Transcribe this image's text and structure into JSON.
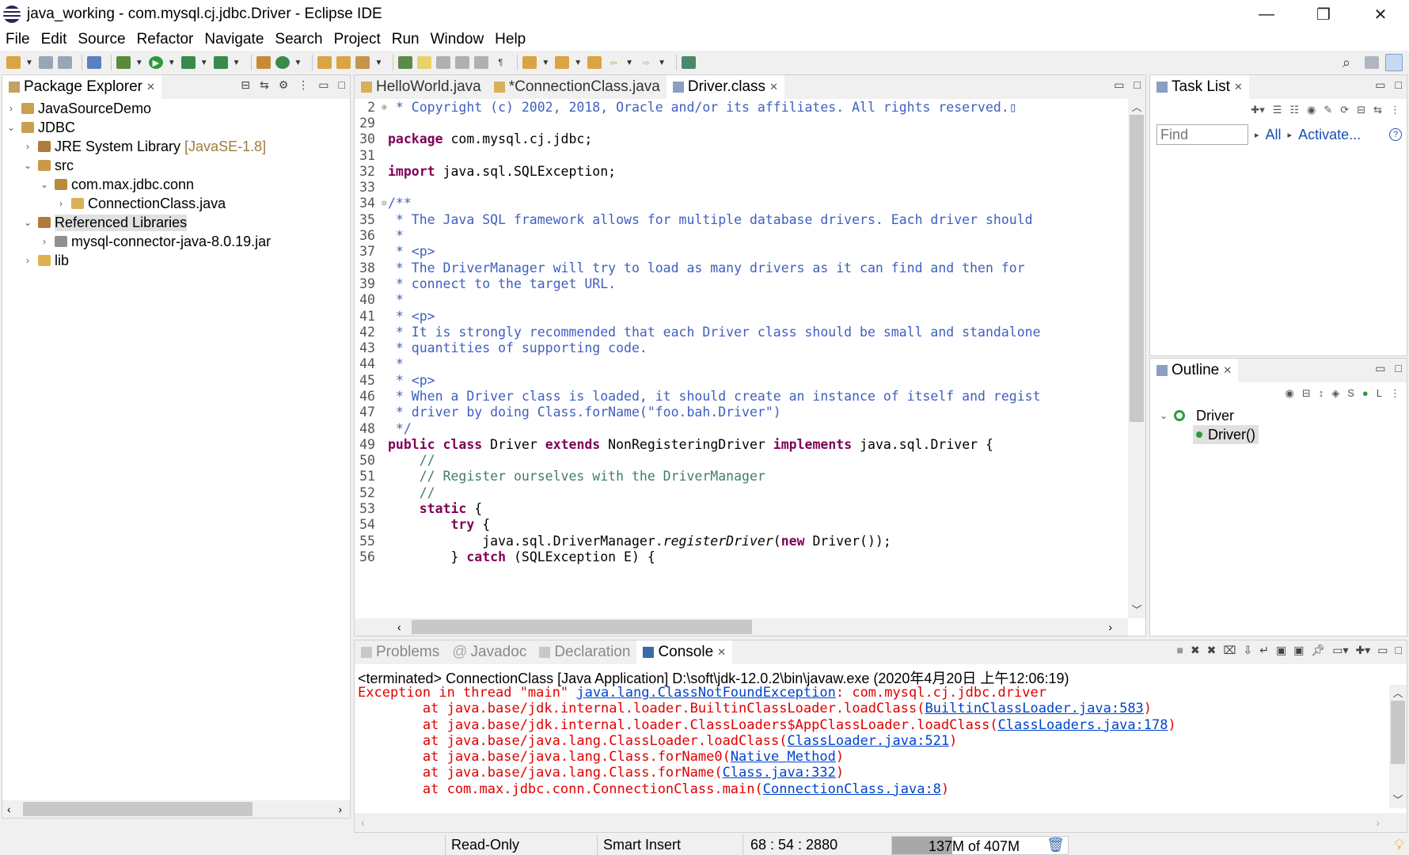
{
  "window": {
    "title": "java_working - com.mysql.cj.jdbc.Driver - Eclipse IDE"
  },
  "menu": [
    "File",
    "Edit",
    "Source",
    "Refactor",
    "Navigate",
    "Search",
    "Project",
    "Run",
    "Window",
    "Help"
  ],
  "package_explorer": {
    "tab": "Package Explorer",
    "items": [
      {
        "label": "JavaSourceDemo",
        "deco": "",
        "arrow": "›",
        "indent": 0,
        "icon": "project-icon"
      },
      {
        "label": "JDBC",
        "deco": "",
        "arrow": "⌄",
        "indent": 0,
        "icon": "project-icon"
      },
      {
        "label": "JRE System Library",
        "deco": "[JavaSE-1.8]",
        "arrow": "›",
        "indent": 1,
        "icon": "library-icon"
      },
      {
        "label": "src",
        "deco": "",
        "arrow": "⌄",
        "indent": 1,
        "icon": "source-folder-icon"
      },
      {
        "label": "com.max.jdbc.conn",
        "deco": "",
        "arrow": "⌄",
        "indent": 2,
        "icon": "package-icon"
      },
      {
        "label": "ConnectionClass.java",
        "deco": "",
        "arrow": "›",
        "indent": 3,
        "icon": "java-file-icon"
      },
      {
        "label": "Referenced Libraries",
        "deco": "",
        "arrow": "⌄",
        "indent": 1,
        "icon": "library-icon",
        "selected": true
      },
      {
        "label": "mysql-connector-java-8.0.19.jar",
        "deco": "",
        "arrow": "›",
        "indent": 2,
        "icon": "jar-icon"
      },
      {
        "label": "lib",
        "deco": "",
        "arrow": "›",
        "indent": 1,
        "icon": "folder-icon"
      }
    ]
  },
  "editor": {
    "tabs": [
      "HelloWorld.java",
      "*ConnectionClass.java",
      "Driver.class"
    ],
    "active_tab": "Driver.class"
  },
  "task_list": {
    "tab": "Task List",
    "find_placeholder": "Find",
    "all": "All",
    "activate": "Activate..."
  },
  "outline": {
    "tab": "Outline",
    "class_name": "Driver",
    "method": "Driver()"
  },
  "bottom": {
    "tabs": [
      "Problems",
      "Javadoc",
      "Declaration",
      "Console"
    ],
    "header": "<terminated> ConnectionClass [Java Application] D:\\soft\\jdk-12.0.2\\bin\\javaw.exe (2020年4月20日 上午12:06:19)"
  },
  "status": {
    "mode": "Read-Only",
    "insert": "Smart Insert",
    "position": "68 : 54 : 2880",
    "memory": "137M of 407M"
  }
}
